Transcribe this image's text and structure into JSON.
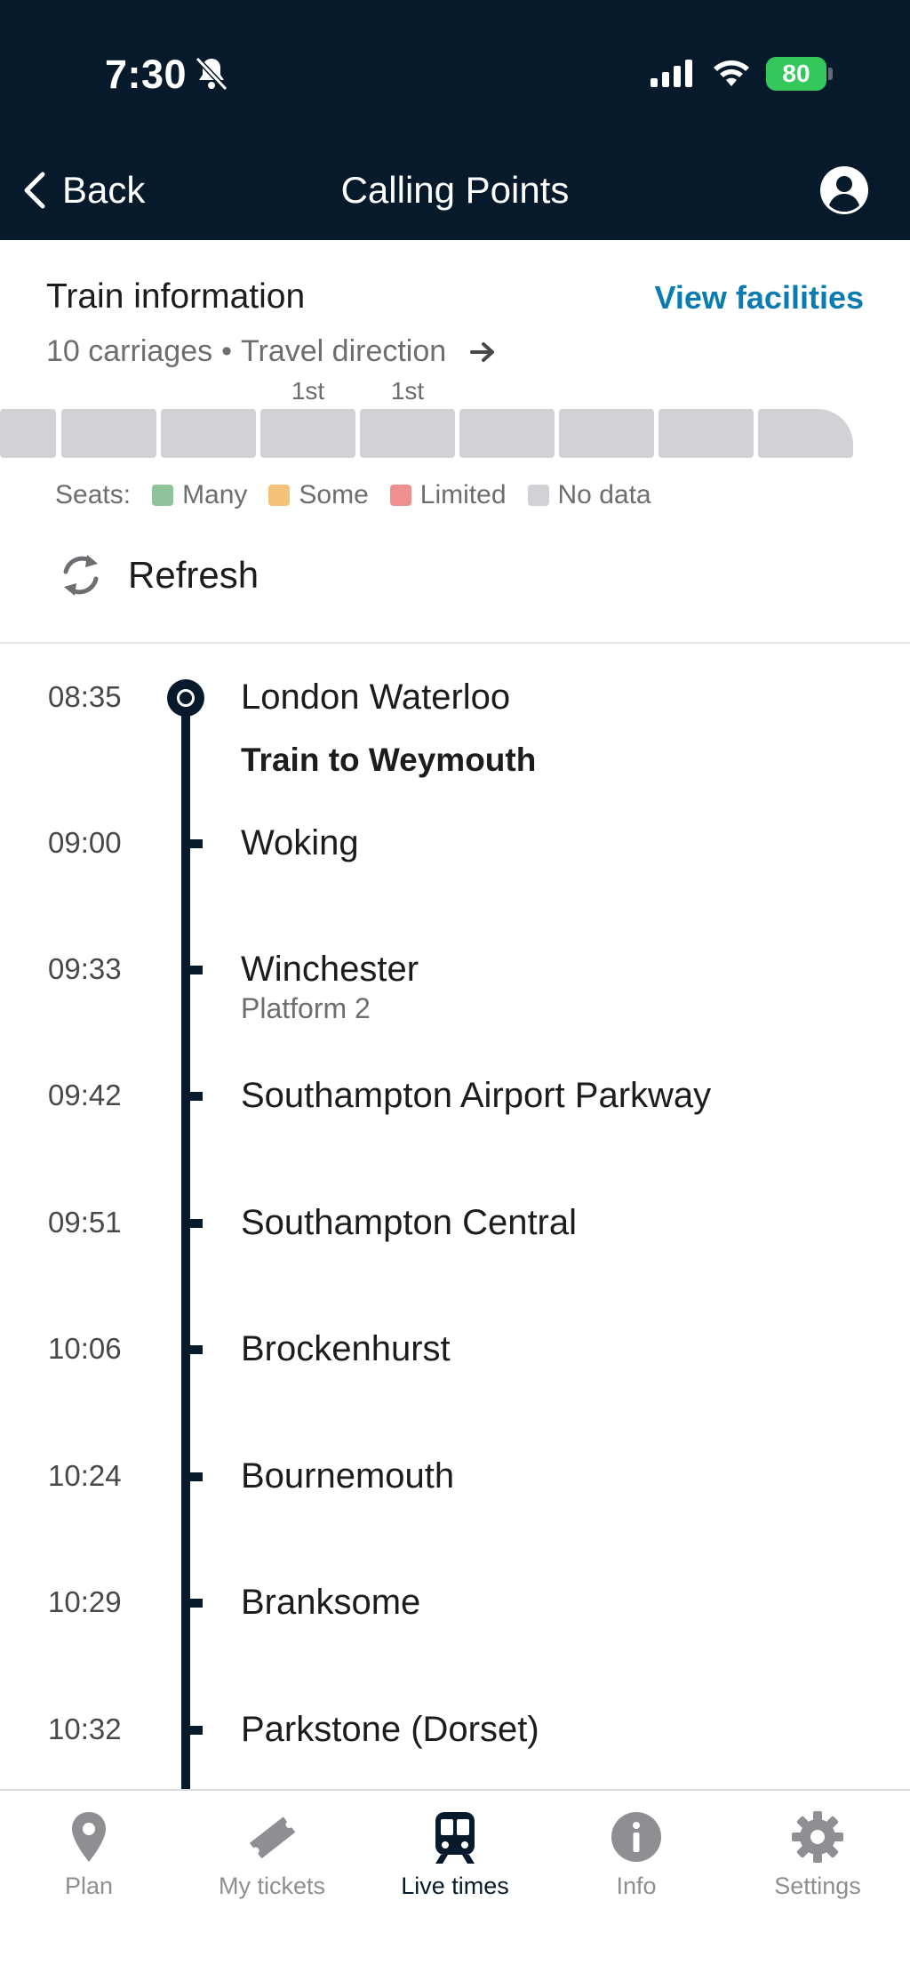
{
  "status": {
    "time": "7:30",
    "battery": "80"
  },
  "nav": {
    "back_label": "Back",
    "title": "Calling Points"
  },
  "train_info": {
    "title": "Train information",
    "view_facilities": "View facilities",
    "carriages": "10 carriages",
    "separator": "•",
    "direction": "Travel direction",
    "first_class_labels": [
      "1st",
      "1st"
    ]
  },
  "legend": {
    "title": "Seats:",
    "items": [
      {
        "label": "Many",
        "color": "#8fc49a"
      },
      {
        "label": "Some",
        "color": "#f5c27a"
      },
      {
        "label": "Limited",
        "color": "#ef8f8f"
      },
      {
        "label": "No data",
        "color": "#d1d1d6"
      }
    ]
  },
  "refresh": {
    "label": "Refresh"
  },
  "headline": "Train to Weymouth",
  "stops": [
    {
      "time": "08:35",
      "name": "London Waterloo"
    },
    {
      "time": "09:00",
      "name": "Woking"
    },
    {
      "time": "09:33",
      "name": "Winchester",
      "platform": "Platform 2"
    },
    {
      "time": "09:42",
      "name": "Southampton Airport Parkway"
    },
    {
      "time": "09:51",
      "name": "Southampton Central"
    },
    {
      "time": "10:06",
      "name": "Brockenhurst"
    },
    {
      "time": "10:24",
      "name": "Bournemouth"
    },
    {
      "time": "10:29",
      "name": "Branksome"
    },
    {
      "time": "10:32",
      "name": "Parkstone (Dorset)"
    }
  ],
  "tabs": [
    {
      "label": "Plan",
      "icon": "location-pin-icon"
    },
    {
      "label": "My tickets",
      "icon": "ticket-icon"
    },
    {
      "label": "Live times",
      "icon": "train-icon",
      "active": true
    },
    {
      "label": "Info",
      "icon": "info-icon"
    },
    {
      "label": "Settings",
      "icon": "gear-icon"
    }
  ],
  "colors": {
    "header": "#061a2c",
    "accent": "#0b7bb0",
    "carriage": "#d1d1d6"
  }
}
